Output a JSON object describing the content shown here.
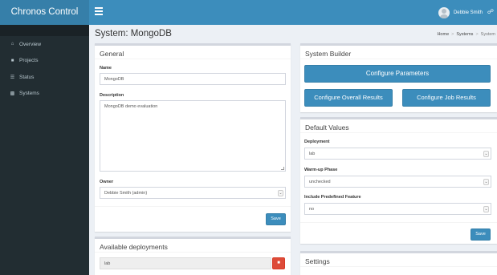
{
  "app": {
    "title": "Chronos Control"
  },
  "header": {
    "user_name": "Debbie Smith"
  },
  "sidebar": {
    "items": [
      {
        "label": "Overview",
        "icon": "home-icon"
      },
      {
        "label": "Projects",
        "icon": "folder-icon"
      },
      {
        "label": "Status",
        "icon": "list-icon"
      },
      {
        "label": "Systems",
        "icon": "cubes-icon"
      }
    ]
  },
  "page": {
    "title": "System: MongoDB",
    "breadcrumb": [
      "Home",
      "Systems",
      "System"
    ]
  },
  "general": {
    "title": "General",
    "name_label": "Name",
    "name_value": "MongoDB",
    "description_label": "Description",
    "description_value": "MongoDB demo evaluation",
    "owner_label": "Owner",
    "owner_value": "Debbie Smith (admin)",
    "save_label": "Save"
  },
  "deployments": {
    "title": "Available deployments",
    "items": [
      "lab"
    ]
  },
  "builder": {
    "title": "System Builder",
    "configure_parameters": "Configure Parameters",
    "configure_overall": "Configure Overall Results",
    "configure_job": "Configure Job Results"
  },
  "defaults": {
    "title": "Default Values",
    "deployment_label": "Deployment",
    "deployment_value": "lab",
    "warmup_label": "Warm-up Phase",
    "warmup_value": "unchecked",
    "predefined_label": "Include Predefined Feature",
    "predefined_value": "no",
    "save_label": "Save"
  },
  "settings": {
    "title": "Settings"
  },
  "colors": {
    "primary": "#3c8dbc",
    "sidebar": "#222d32",
    "danger": "#dd4b39"
  }
}
